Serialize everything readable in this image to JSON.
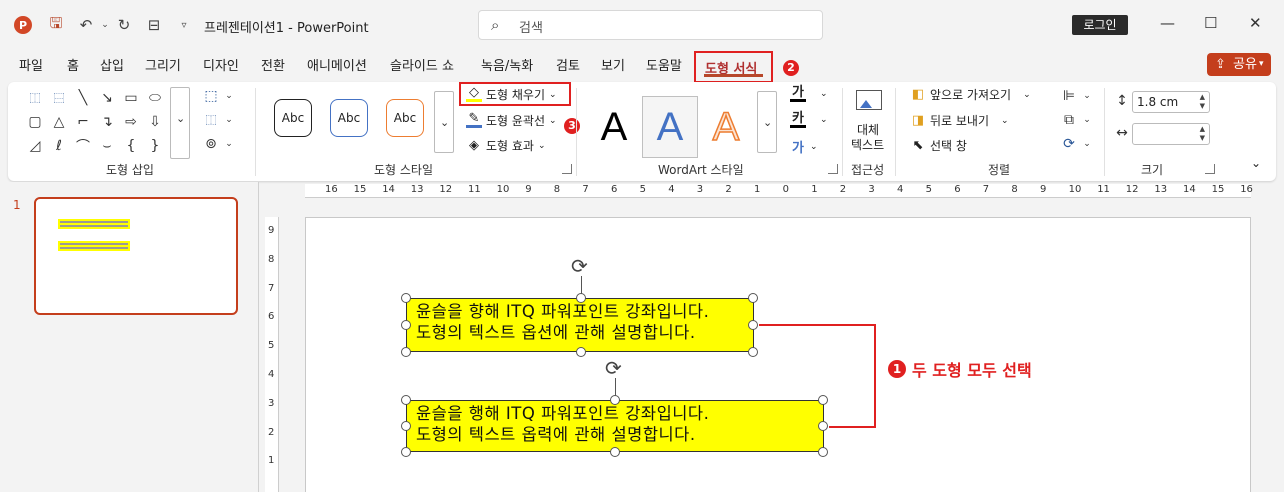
{
  "titlebar": {
    "app_logo": "P",
    "save_icon": "save-icon",
    "undo": "↶",
    "redo": "↻",
    "doc_title": "프레젠테이션1 - PowerPoint",
    "search_placeholder": "검색",
    "login": "로그인"
  },
  "tabs": [
    "파일",
    "홈",
    "삽입",
    "그리기",
    "디자인",
    "전환",
    "애니메이션",
    "슬라이드 쇼",
    "녹음/녹화",
    "검토",
    "보기",
    "도움말"
  ],
  "active_tab": "도형 서식",
  "share": "공유",
  "ribbon": {
    "insert_shapes_label": "도형 삽입",
    "shape_styles_label": "도형 스타일",
    "style_samples": [
      "Abc",
      "Abc",
      "Abc"
    ],
    "fill": "도형 채우기",
    "outline": "도형 윤곽선",
    "effects": "도형 효과",
    "wordart_label": "WordArt 스타일",
    "wordart_samples": [
      "A",
      "A",
      "A"
    ],
    "text_fill_glyph": "가",
    "text_outline_glyph": "카",
    "text_effect_glyph": "가",
    "alt_text_line1": "대체",
    "alt_text_line2": "텍스트",
    "accessibility_label": "접근성",
    "bring_forward": "앞으로 가져오기",
    "send_backward": "뒤로 보내기",
    "selection_pane": "선택 창",
    "arrange_label": "정렬",
    "height_value": "1.8 cm",
    "width_value": "",
    "size_label": "크기"
  },
  "badges": {
    "b1": "1",
    "b2": "2",
    "b3": "3"
  },
  "callout_text": "두 도형 모두 선택",
  "thumb": {
    "slide_number": "1"
  },
  "ruler": {
    "h": [
      "16",
      "15",
      "14",
      "13",
      "12",
      "11",
      "10",
      "9",
      "8",
      "7",
      "6",
      "5",
      "4",
      "3",
      "2",
      "1",
      "0",
      "1",
      "2",
      "3",
      "4",
      "5",
      "6",
      "7",
      "8",
      "9",
      "10",
      "11",
      "12",
      "13",
      "14",
      "15",
      "16"
    ],
    "v": [
      "9",
      "8",
      "7",
      "6",
      "5",
      "4",
      "3",
      "2",
      "1"
    ]
  },
  "shape1": {
    "line1": "윤슬을 향해 ITQ 파워포인트 강좌입니다.",
    "line2": "도형의 텍스트 옵션에 관해 설명합니다."
  },
  "shape2": {
    "line1": "윤슬을 행해 ITQ 파워포인트 강좌입니다.",
    "line2": "도형의 텍스트 옵력에 관해 설명합니다."
  },
  "colors": {
    "accent": "#c43e1c",
    "highlight": "#ffff00",
    "annotation": "#e02020"
  }
}
